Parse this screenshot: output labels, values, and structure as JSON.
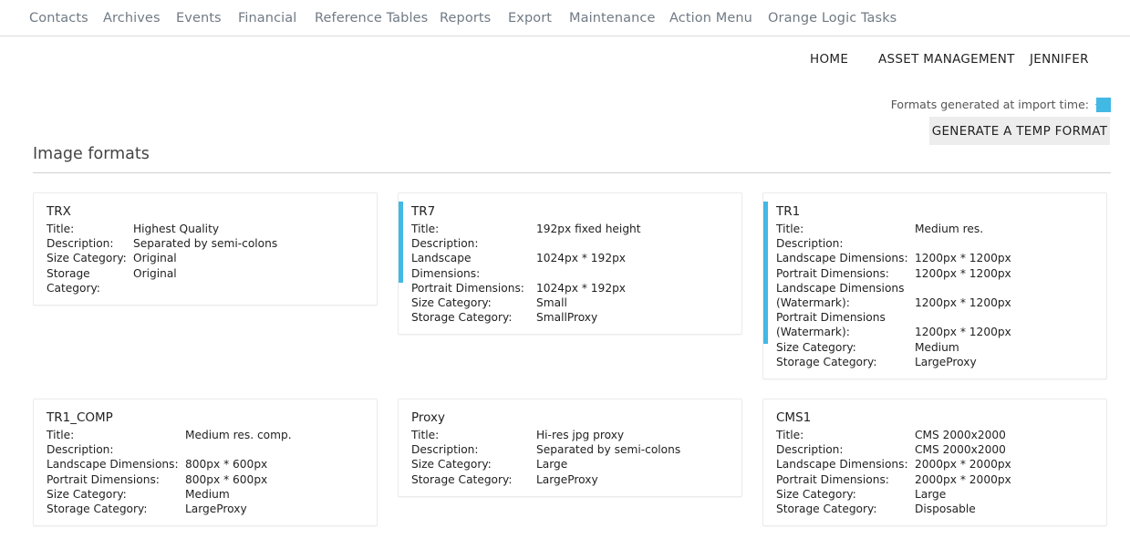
{
  "topnav": [
    "Contacts",
    "Archives",
    "Events",
    "Financial",
    "Reference Tables",
    "Reports",
    "Export",
    "Maintenance",
    "Action Menu",
    "Orange Logic Tasks"
  ],
  "subnav": {
    "home": "HOME",
    "asset_management": "ASSET MANAGEMENT",
    "user": "JENNIFER"
  },
  "legend": {
    "text": "Formats generated at import time:",
    "color": "#42b8e5"
  },
  "generate_button": "GENERATE A TEMP FORMAT",
  "section_title": "Image formats",
  "cards": [
    {
      "name": "TRX",
      "accent": false,
      "rows": [
        [
          "Title:",
          "Highest Quality"
        ],
        [
          "Description:",
          "Separated by semi-colons"
        ],
        [
          "Size Category:",
          "Original"
        ],
        [
          "Storage Category:",
          "Original"
        ]
      ]
    },
    {
      "name": "TR7",
      "accent": true,
      "rows": [
        [
          "Title:",
          "192px fixed height"
        ],
        [
          "Description:",
          ""
        ],
        [
          "Landscape Dimensions:",
          "1024px * 192px"
        ],
        [
          "Portrait Dimensions:",
          "1024px * 192px"
        ],
        [
          "Size Category:",
          "Small"
        ],
        [
          "Storage Category:",
          "SmallProxy"
        ]
      ]
    },
    {
      "name": "TR1",
      "accent": true,
      "rows": [
        [
          "Title:",
          "Medium res."
        ],
        [
          "Description:",
          ""
        ],
        [
          "Landscape Dimensions:",
          "1200px * 1200px"
        ],
        [
          "Portrait Dimensions:",
          "1200px * 1200px"
        ],
        [
          "Landscape Dimensions (Watermark):",
          "1200px * 1200px"
        ],
        [
          "Portrait Dimensions (Watermark):",
          "1200px * 1200px"
        ],
        [
          "Size Category:",
          "Medium"
        ],
        [
          "Storage Category:",
          "LargeProxy"
        ]
      ]
    },
    {
      "name": "TR1_COMP",
      "accent": false,
      "rows": [
        [
          "Title:",
          "Medium res. comp."
        ],
        [
          "Description:",
          ""
        ],
        [
          "Landscape Dimensions:",
          "800px * 600px"
        ],
        [
          "Portrait Dimensions:",
          "800px * 600px"
        ],
        [
          "Size Category:",
          "Medium"
        ],
        [
          "Storage Category:",
          "LargeProxy"
        ]
      ]
    },
    {
      "name": "Proxy",
      "accent": false,
      "rows": [
        [
          "Title:",
          "Hi-res jpg proxy"
        ],
        [
          "Description:",
          "Separated by semi-colons"
        ],
        [
          "Size Category:",
          "Large"
        ],
        [
          "Storage Category:",
          "LargeProxy"
        ]
      ]
    },
    {
      "name": "CMS1",
      "accent": false,
      "rows": [
        [
          "Title:",
          "CMS 2000x2000"
        ],
        [
          "Description:",
          "CMS 2000x2000"
        ],
        [
          "Landscape Dimensions:",
          "2000px * 2000px"
        ],
        [
          "Portrait Dimensions:",
          "2000px * 2000px"
        ],
        [
          "Size Category:",
          "Large"
        ],
        [
          "Storage Category:",
          "Disposable"
        ]
      ]
    }
  ]
}
